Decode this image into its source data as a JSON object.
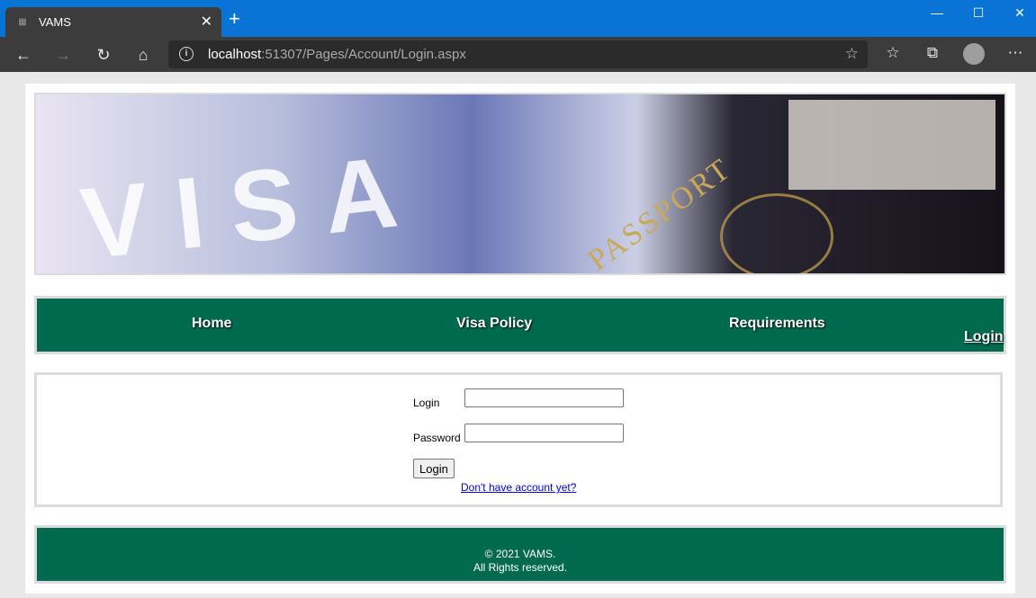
{
  "browser": {
    "tab_title": "VAMS",
    "favicon": "vams-favicon",
    "close_glyph": "✕",
    "newtab_glyph": "+",
    "url_host": "localhost",
    "url_rest": ":51307/Pages/Account/Login.aspx",
    "window_controls": [
      "—",
      "☐",
      "✕"
    ]
  },
  "banner": {
    "visa_text": "VISA",
    "passport_text": "PASSPORT"
  },
  "nav": {
    "home": "Home",
    "visa_policy": "Visa Policy",
    "requirements": "Requirements",
    "login": "Login"
  },
  "login_form": {
    "login_label": "Login",
    "password_label": "Password",
    "login_value": "",
    "password_value": "",
    "submit_label": "Login",
    "register_link": "Don't have account yet?"
  },
  "footer": {
    "copyright": "© 2021 VAMS.",
    "rights": "All Rights reserved."
  },
  "colors": {
    "nav_green": "#006a4e",
    "titlebar_blue": "#0a74d6"
  }
}
